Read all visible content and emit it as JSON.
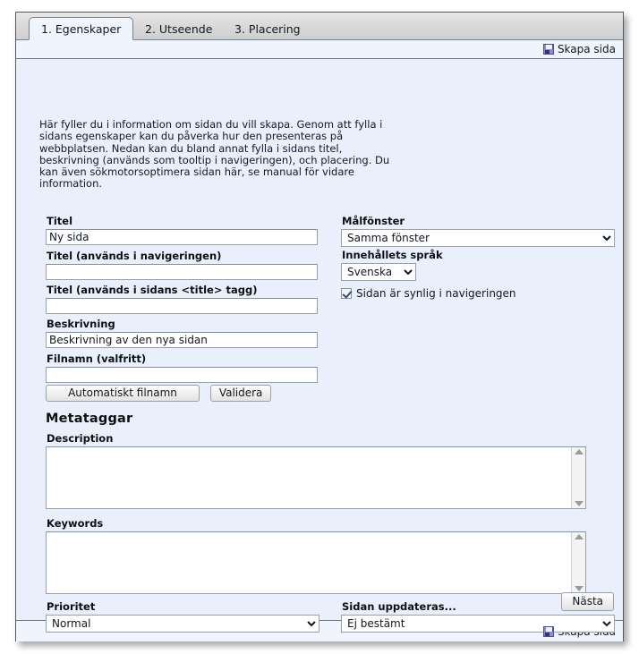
{
  "tabs": [
    {
      "label": "1. Egenskaper",
      "active": true
    },
    {
      "label": "2. Utseende",
      "active": false
    },
    {
      "label": "3. Placering",
      "active": false
    }
  ],
  "toolbar": {
    "save_label": "Skapa sida",
    "save_icon": "floppy-disk-icon"
  },
  "intro": "Här fyller du i information om sidan du vill skapa. Genom att fylla i sidans egenskaper kan du påverka hur den presenteras på webbplatsen. Nedan kan du bland annat fylla i sidans titel, beskrivning (används som tooltip i navigeringen), och placering. Du kan även sökmotorsoptimera sidan här, se manual för vidare information.",
  "form": {
    "titel": {
      "label": "Titel",
      "value": "Ny sida",
      "placeholder": ""
    },
    "titel_nav": {
      "label": "Titel (används i navigeringen)",
      "value": "",
      "placeholder": ""
    },
    "titel_tag": {
      "label": "Titel (används i sidans <title> tagg)",
      "value": "",
      "placeholder": ""
    },
    "beskrivning": {
      "label": "Beskrivning",
      "value": "Beskrivning av den nya sidan",
      "placeholder": ""
    },
    "filnamn": {
      "label": "Filnamn (valfritt)",
      "value": "",
      "placeholder": ""
    },
    "auto_filename_button": "Automatiskt filnamn",
    "validate_button": "Validera",
    "malfonster": {
      "label": "Målfönster",
      "value": "Samma fönster",
      "options": [
        "Samma fönster"
      ]
    },
    "sprak": {
      "label": "Innehållets språk",
      "value": "Svenska",
      "options": [
        "Svenska"
      ]
    },
    "visible_checkbox": {
      "label": "Sidan är synlig i navigeringen",
      "checked": true
    }
  },
  "meta": {
    "heading": "Metataggar",
    "description": {
      "label": "Description",
      "value": "",
      "placeholder": ""
    },
    "keywords": {
      "label": "Keywords",
      "value": "",
      "placeholder": ""
    }
  },
  "footerfields": {
    "prioritet": {
      "label": "Prioritet",
      "value": "Normal",
      "options": [
        "Normal"
      ]
    },
    "uppdateras": {
      "label": "Sidan uppdateras...",
      "value": "Ej bestämt",
      "options": [
        "Ej bestämt"
      ]
    }
  },
  "next_button": "Nästa"
}
